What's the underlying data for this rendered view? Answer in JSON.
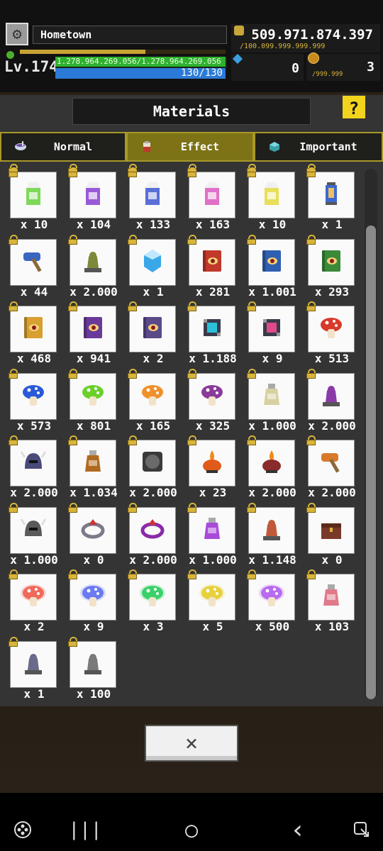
{
  "header": {
    "location": "Hometown",
    "level": "Lv.174",
    "xp_fraction": 0.61,
    "hp_text": "1.278.964.269.056/1.278.964.269.056",
    "hp_fraction": 1.0,
    "mp_text": "130/130",
    "mp_fraction": 1.0,
    "gold": "509.971.874.397",
    "gold_cap": "/100.099.999.999.999",
    "gems": "0",
    "coins": "3",
    "coin_cap": "/999.999"
  },
  "panel": {
    "title": "Materials",
    "help_label": "?",
    "tabs": [
      {
        "label": "Normal",
        "icon": "bowl-icon",
        "active": false
      },
      {
        "label": "Effect",
        "icon": "potion-jar-icon",
        "active": true
      },
      {
        "label": "Important",
        "icon": "cube-gem-icon",
        "active": false
      }
    ],
    "items": [
      {
        "qty": "x 10",
        "icon": "milk-carton-green-icon",
        "color": "#7fd85a"
      },
      {
        "qty": "x 104",
        "icon": "milk-carton-purple-icon",
        "color": "#9a5ad8"
      },
      {
        "qty": "x 133",
        "icon": "milk-carton-blue-icon",
        "color": "#5a6ed8"
      },
      {
        "qty": "x 163",
        "icon": "milk-carton-pink-icon",
        "color": "#e070c8"
      },
      {
        "qty": "x 10",
        "icon": "milk-carton-yellow-icon",
        "color": "#e8df5a"
      },
      {
        "qty": "x 1",
        "icon": "blue-lantern-icon",
        "color": "#3a6ad0"
      },
      {
        "qty": "x 44",
        "icon": "blue-hammer-icon",
        "color": "#3a66c0"
      },
      {
        "qty": "x 2.000",
        "icon": "treant-idol-icon",
        "color": "#7a8a3a"
      },
      {
        "qty": "x 1",
        "icon": "blue-crystal-icon",
        "color": "#3aa8e8"
      },
      {
        "qty": "x 281",
        "icon": "red-eye-book-icon",
        "color": "#c0392b"
      },
      {
        "qty": "x 1.001",
        "icon": "blue-eye-book-icon",
        "color": "#2e5fb0"
      },
      {
        "qty": "x 293",
        "icon": "green-eye-book-icon",
        "color": "#3a8a3a"
      },
      {
        "qty": "x 468",
        "icon": "gold-eye-book-icon",
        "color": "#d8a030"
      },
      {
        "qty": "x 941",
        "icon": "purple-eye-book-icon",
        "color": "#6a3a9a"
      },
      {
        "qty": "x 2",
        "icon": "ancient-tome-icon",
        "color": "#5a4a8a"
      },
      {
        "qty": "x 1.188",
        "icon": "cyan-runic-cube-icon",
        "color": "#2ac0d8"
      },
      {
        "qty": "x 9",
        "icon": "pink-runic-cube-icon",
        "color": "#e04a8a"
      },
      {
        "qty": "x 513",
        "icon": "red-mushroom-icon",
        "color": "#d83a2a"
      },
      {
        "qty": "x 573",
        "icon": "blue-mushroom-icon",
        "color": "#2a5ad8"
      },
      {
        "qty": "x 801",
        "icon": "green-mushroom-icon",
        "color": "#6ad02a"
      },
      {
        "qty": "x 165",
        "icon": "orange-mushroom-icon",
        "color": "#f0902a"
      },
      {
        "qty": "x 325",
        "icon": "purple-mushroom-icon",
        "color": "#8a3a9a"
      },
      {
        "qty": "x 1.000",
        "icon": "herb-jar-icon",
        "color": "#d8d0a0"
      },
      {
        "qty": "x 2.000",
        "icon": "dragon-statue-icon",
        "color": "#8a3aa8"
      },
      {
        "qty": "x 2.000",
        "icon": "horned-helmet-icon",
        "color": "#4a4a7a"
      },
      {
        "qty": "x 1.034",
        "icon": "cross-flask-icon",
        "color": "#b06a20"
      },
      {
        "qty": "x 2.000",
        "icon": "griffin-emblem-icon",
        "color": "#6a6a6a"
      },
      {
        "qty": "x 23",
        "icon": "fire-brazier-icon",
        "color": "#e05a1a"
      },
      {
        "qty": "x 2.000",
        "icon": "dark-cauldron-icon",
        "color": "#8a2a2a"
      },
      {
        "qty": "x 2.000",
        "icon": "orange-horn-icon",
        "color": "#d87a2a"
      },
      {
        "qty": "x 1.000",
        "icon": "spartan-helmet-icon",
        "color": "#5a5a5a"
      },
      {
        "qty": "x 0",
        "icon": "spiked-ring-icon",
        "color": "#7a7a8a"
      },
      {
        "qty": "x 2.000",
        "icon": "dragon-ring-icon",
        "color": "#8a2aa8"
      },
      {
        "qty": "x 1.000",
        "icon": "quill-inkpot-icon",
        "color": "#a84ad8"
      },
      {
        "qty": "x 1.148",
        "icon": "fanged-altar-icon",
        "color": "#c05a3a"
      },
      {
        "qty": "x 0",
        "icon": "treasure-chest-icon",
        "color": "#7a3a2a"
      },
      {
        "qty": "x 2",
        "icon": "glowing-red-mushroom-icon",
        "color": "#f06a5a"
      },
      {
        "qty": "x 9",
        "icon": "glowing-blue-mushroom-icon",
        "color": "#6a7af0"
      },
      {
        "qty": "x 3",
        "icon": "glowing-green-mushroom-icon",
        "color": "#3ad06a"
      },
      {
        "qty": "x 5",
        "icon": "glowing-yellow-mushroom-icon",
        "color": "#e8d03a"
      },
      {
        "qty": "x 500",
        "icon": "glowing-violet-mushroom-icon",
        "color": "#b86af0"
      },
      {
        "qty": "x 103",
        "icon": "pink-potion-bottle-icon",
        "color": "#e07a8a"
      },
      {
        "qty": "x 1",
        "icon": "gargoyle-statue-icon",
        "color": "#6a6a8a"
      },
      {
        "qty": "x 100",
        "icon": "knight-statue-icon",
        "color": "#7a7a7a"
      }
    ],
    "close_label": "×"
  },
  "system_nav": {
    "recents": "|||",
    "home": "○",
    "back": "‹"
  }
}
